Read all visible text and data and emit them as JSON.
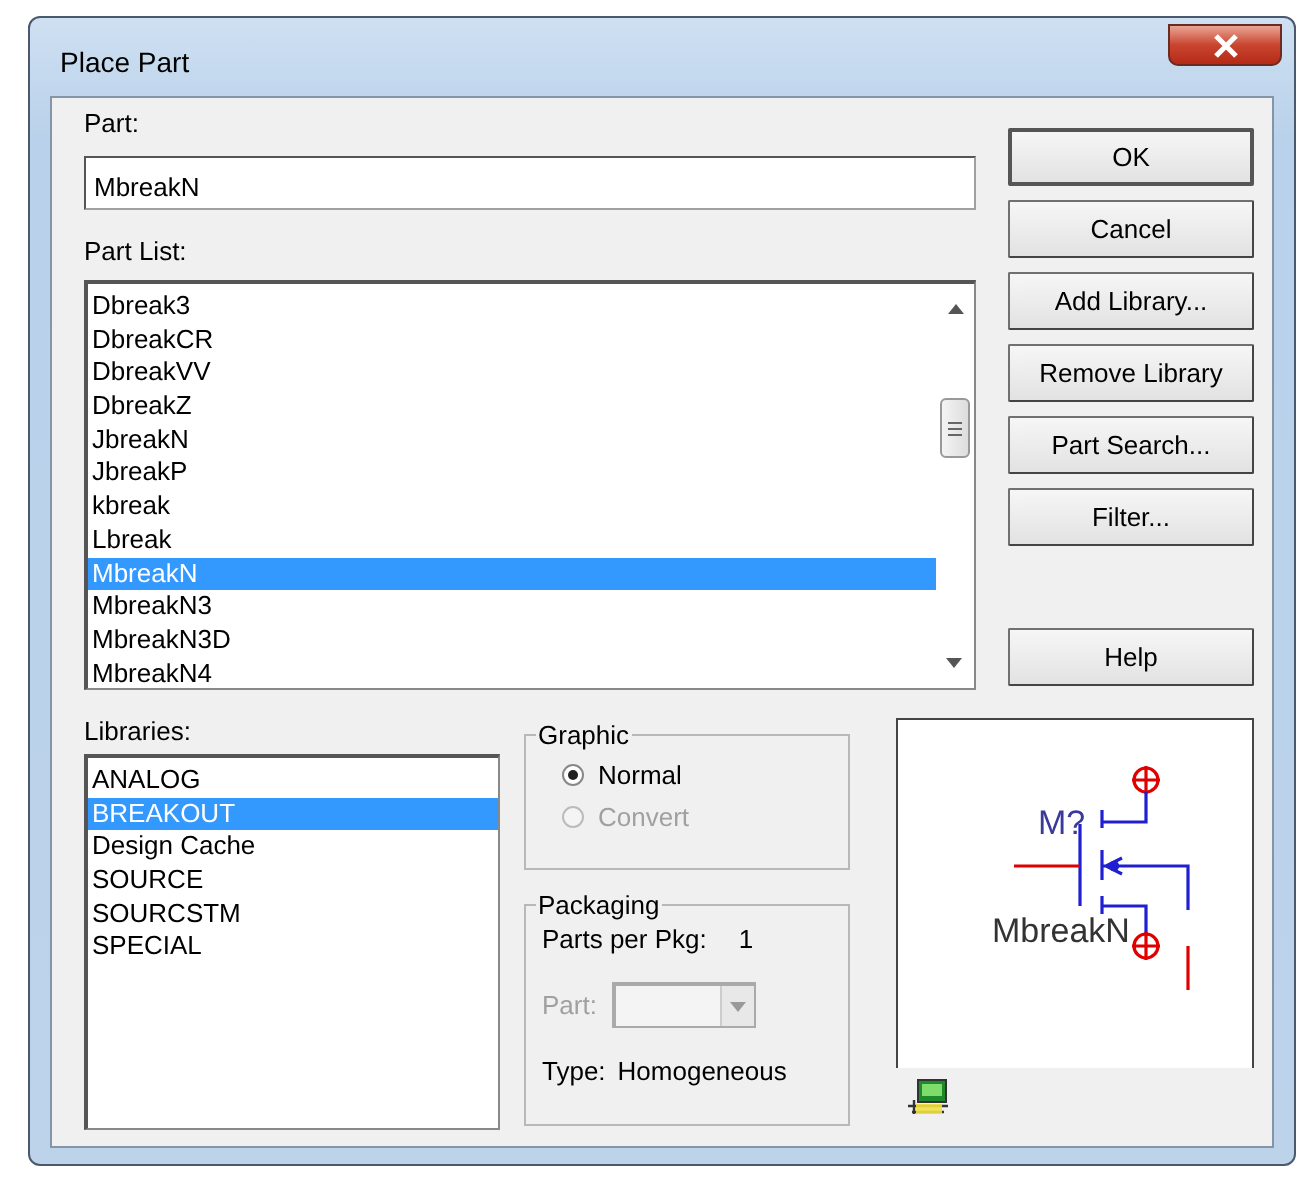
{
  "window": {
    "title": "Place Part"
  },
  "part_field": {
    "label": "Part:",
    "value": "MbreakN"
  },
  "part_list": {
    "label": "Part List:",
    "items": [
      {
        "label": "Dbreak3",
        "selected": false
      },
      {
        "label": "DbreakCR",
        "selected": false
      },
      {
        "label": "DbreakVV",
        "selected": false
      },
      {
        "label": "DbreakZ",
        "selected": false
      },
      {
        "label": "JbreakN",
        "selected": false
      },
      {
        "label": "JbreakP",
        "selected": false
      },
      {
        "label": "kbreak",
        "selected": false
      },
      {
        "label": "Lbreak",
        "selected": false
      },
      {
        "label": "MbreakN",
        "selected": true
      },
      {
        "label": "MbreakN3",
        "selected": false
      },
      {
        "label": "MbreakN3D",
        "selected": false
      },
      {
        "label": "MbreakN4",
        "selected": false
      }
    ]
  },
  "buttons": [
    {
      "label": "OK",
      "kind": "default"
    },
    {
      "label": "Cancel",
      "kind": "normal"
    },
    {
      "label": "Add Library...",
      "kind": "normal"
    },
    {
      "label": "Remove Library",
      "kind": "normal"
    },
    {
      "label": "Part Search...",
      "kind": "normal"
    },
    {
      "label": "Filter...",
      "kind": "normal"
    },
    {
      "label": "Help",
      "kind": "separated"
    }
  ],
  "libraries": {
    "label": "Libraries:",
    "items": [
      {
        "label": "ANALOG",
        "selected": false
      },
      {
        "label": "BREAKOUT",
        "selected": true
      },
      {
        "label": "Design Cache",
        "selected": false
      },
      {
        "label": "SOURCE",
        "selected": false
      },
      {
        "label": "SOURCSTM",
        "selected": false
      },
      {
        "label": "SPECIAL",
        "selected": false
      }
    ]
  },
  "graphic": {
    "title": "Graphic",
    "options": [
      {
        "label": "Normal",
        "selected": true,
        "disabled": false
      },
      {
        "label": "Convert",
        "selected": false,
        "disabled": true
      }
    ]
  },
  "packaging": {
    "title": "Packaging",
    "parts_per_pkg_label": "Parts per Pkg:",
    "parts_per_pkg_value": "1",
    "part_label": "Part:",
    "part_disabled": true,
    "type_label": "Type:",
    "type_value": "Homogeneous"
  },
  "preview": {
    "reference": "M?",
    "part_name": "MbreakN"
  }
}
